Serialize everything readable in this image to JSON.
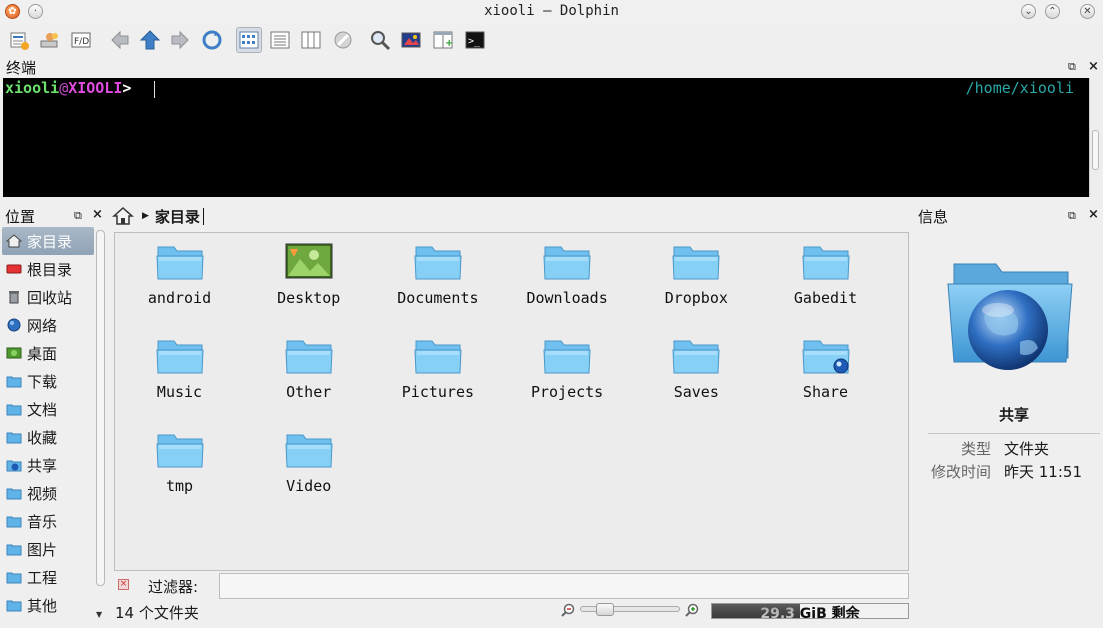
{
  "window": {
    "title": "xiooli — Dolphin"
  },
  "toolbar": {
    "icons": [
      "settings-icon",
      "user-icon",
      "compare-icon",
      "back-icon",
      "up-icon",
      "forward-icon",
      "reload-icon",
      "icon-view-icon",
      "details-view-icon",
      "columns-view-icon",
      "hidden-files-icon",
      "find-icon",
      "preview-icon",
      "split-view-icon",
      "terminal-icon"
    ]
  },
  "terminal_panel": {
    "title": "终端",
    "user": "xiooli",
    "at": "@",
    "host": "XIOOLI",
    "prompt": ">",
    "cwd": "/home/xiooli"
  },
  "places_panel": {
    "title": "位置",
    "items": [
      {
        "label": "家目录",
        "icon": "home-icon",
        "selected": true
      },
      {
        "label": "根目录",
        "icon": "drive-icon"
      },
      {
        "label": "回收站",
        "icon": "trash-icon"
      },
      {
        "label": "网络",
        "icon": "network-icon"
      },
      {
        "label": "桌面",
        "icon": "desktop-icon"
      },
      {
        "label": "下载",
        "icon": "folder-icon"
      },
      {
        "label": "文档",
        "icon": "folder-icon"
      },
      {
        "label": "收藏",
        "icon": "folder-icon"
      },
      {
        "label": "共享",
        "icon": "shared-folder-icon"
      },
      {
        "label": "视频",
        "icon": "folder-icon"
      },
      {
        "label": "音乐",
        "icon": "folder-icon"
      },
      {
        "label": "图片",
        "icon": "folder-icon"
      },
      {
        "label": "工程",
        "icon": "folder-icon"
      },
      {
        "label": "其他",
        "icon": "folder-icon"
      }
    ]
  },
  "breadcrumb": {
    "location": "家目录"
  },
  "files": [
    {
      "name": "android",
      "type": "folder"
    },
    {
      "name": "Desktop",
      "type": "desktop"
    },
    {
      "name": "Documents",
      "type": "folder"
    },
    {
      "name": "Downloads",
      "type": "folder"
    },
    {
      "name": "Dropbox",
      "type": "folder"
    },
    {
      "name": "Gabedit",
      "type": "folder"
    },
    {
      "name": "Music",
      "type": "folder"
    },
    {
      "name": "Other",
      "type": "folder"
    },
    {
      "name": "Pictures",
      "type": "folder"
    },
    {
      "name": "Projects",
      "type": "folder"
    },
    {
      "name": "Saves",
      "type": "folder"
    },
    {
      "name": "Share",
      "type": "shared"
    },
    {
      "name": "tmp",
      "type": "folder"
    },
    {
      "name": "Video",
      "type": "folder"
    }
  ],
  "filter": {
    "label": "过滤器:",
    "value": ""
  },
  "status": {
    "count": "14 个文件夹",
    "free_space": "29.3 GiB 剩余",
    "disk_used_fraction": 0.45
  },
  "info_panel": {
    "title": "信息",
    "item_name": "共享",
    "type_label": "类型",
    "type_value": "文件夹",
    "modified_label": "修改时间",
    "modified_value": "昨天 11:51"
  }
}
